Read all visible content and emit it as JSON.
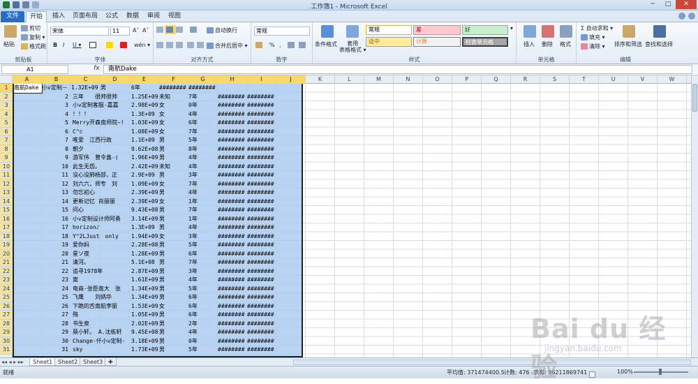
{
  "window": {
    "title": "工作簿1 - Microsoft Excel"
  },
  "tabs": [
    "文件",
    "开始",
    "插入",
    "页面布局",
    "公式",
    "数据",
    "审阅",
    "视图"
  ],
  "ribbon": {
    "clipboard": {
      "paste": "粘贴",
      "cut": "剪切",
      "copy": "复制 ▾",
      "format_painter": "格式刷",
      "label": "剪贴板"
    },
    "font": {
      "name": "宋体",
      "size": "11",
      "grow": "A˄",
      "shrink": "A˅",
      "bold": "B",
      "italic": "I",
      "underline": "U ▾",
      "label": "字体",
      "phonetic": "wén ▾"
    },
    "alignment": {
      "wrap": "自动换行",
      "merge": "合并后居中 ▾",
      "label": "对齐方式"
    },
    "number": {
      "format": "常规",
      "percent": "%",
      "comma": ",",
      "label": "数字"
    },
    "styles": {
      "conditional": "条件格式",
      "table_format": "套用\n表格格式 ▾",
      "normal": "常规",
      "bad": "差",
      "good": "好",
      "neutral": "适中",
      "calc": "计算",
      "check": "检查单元格",
      "label": "样式"
    },
    "cells": {
      "insert": "插入",
      "delete": "删除",
      "format": "格式",
      "label": "单元格"
    },
    "editing": {
      "autosum": "Σ 自动求和 ▾",
      "fill": "填充 ▾",
      "clear": "清除 ▾",
      "sort": "排序和筛选",
      "find": "查找和选择",
      "label": "编辑"
    },
    "colors": {
      "file_tab": "#2a6cc0",
      "bad_bg": "#ffc7ce",
      "good_bg": "#c6efce",
      "neutral_bg": "#ffeb9c",
      "calc_bg": "#f2f2f2",
      "check_bg": "#a5a5a5"
    }
  },
  "formula_bar": {
    "name_box": "A1",
    "fx": "fx",
    "value": "南航Dake"
  },
  "columns": [
    "A",
    "B",
    "C",
    "D",
    "E",
    "F",
    "G",
    "H",
    "I",
    "J",
    "K",
    "L",
    "M",
    "N",
    "O",
    "P",
    "Q",
    "R",
    "S",
    "T",
    "U",
    "V",
    "W"
  ],
  "rows": [
    [
      "南航Dake",
      "小v定制－",
      "1.32E+09",
      "男",
      "",
      "6年",
      "########",
      "########"
    ],
    [
      "",
      "2",
      "三年　　很帅很帅",
      "1.25E+09",
      "未知",
      "7年",
      "########",
      "########"
    ],
    [
      "",
      "3",
      "小v定制客服-嘉嘉",
      "2.98E+09",
      "女",
      "0年",
      "########",
      "########"
    ],
    [
      "",
      "4",
      "！！！",
      "1.3E+09",
      "女",
      "4年",
      "########",
      "########"
    ],
    [
      "",
      "5",
      "Merry开森南师院~!",
      "1.03E+09",
      "女",
      "6年",
      "########",
      "########"
    ],
    [
      "",
      "6",
      "C^c",
      "1.08E+09",
      "女",
      "7年",
      "########",
      "########"
    ],
    [
      "",
      "7",
      "唯爱　江西行政",
      "1.1E+09",
      "男",
      "5年",
      "########",
      "########"
    ],
    [
      "",
      "8",
      "朝夕",
      "9.62E+08",
      "男",
      "8年",
      "########",
      "########"
    ],
    [
      "",
      "9",
      "游军伟　曾令鑫-(",
      "1.96E+09",
      "男",
      "4年",
      "########",
      "########"
    ],
    [
      "",
      "10",
      "此生无怨。",
      "2.42E+09",
      "未知",
      "4年",
      "########",
      "########"
    ],
    [
      "",
      "11",
      "没心没肺杨部，正",
      "2.9E+09",
      "男",
      "3年",
      "########",
      "########"
    ],
    [
      "",
      "12",
      "刘六六，师专　刘",
      "1.09E+09",
      "女",
      "7年",
      "########",
      "########"
    ],
    [
      "",
      "13",
      "勿忘初心",
      "2.39E+09",
      "男",
      "4年",
      "########",
      "########"
    ],
    [
      "",
      "14",
      "更新记忆 肖丽丽",
      "2.39E+09",
      "女",
      "1年",
      "########",
      "########"
    ],
    [
      "",
      "15",
      "问心",
      "9.43E+08",
      "男",
      "7年",
      "########",
      "########"
    ],
    [
      "",
      "16",
      "小v定制设计师阿勇",
      "3.14E+09",
      "男",
      "1年",
      "########",
      "########"
    ],
    [
      "",
      "17",
      "horizon♪",
      "1.3E+09",
      "男",
      "4年",
      "########",
      "########"
    ],
    [
      "",
      "18",
      "Y^2LJust　only",
      "1.94E+09",
      "女",
      "3年",
      "########",
      "########"
    ],
    [
      "",
      "19",
      "爱你妈",
      "2.28E+08",
      "男",
      "5年",
      "########",
      "########"
    ],
    [
      "",
      "20",
      "星ソ夜",
      "1.28E+09",
      "男",
      "6年",
      "########",
      "########"
    ],
    [
      "",
      "21",
      "清河。",
      "5.1E+08",
      "男",
      "7年",
      "########",
      "########"
    ],
    [
      "",
      "22",
      "追寻1978年",
      "2.87E+09",
      "男",
      "3年",
      "########",
      "########"
    ],
    [
      "",
      "23",
      "寞",
      "1.61E+09",
      "男",
      "4年",
      "########",
      "########"
    ],
    [
      "",
      "24",
      "电商-张臣南大　张",
      "1.34E+09",
      "男",
      "5年",
      "########",
      "########"
    ],
    [
      "",
      "25",
      "飞鹰　　刘炳华",
      "1.34E+09",
      "男",
      "6年",
      "########",
      "########"
    ],
    [
      "",
      "26",
      "下跪的舌南航李丽",
      "1.53E+09",
      "女",
      "6年",
      "########",
      "########"
    ],
    [
      "",
      "27",
      "殇",
      "1.05E+09",
      "男",
      "6年",
      "########",
      "########"
    ],
    [
      "",
      "28",
      "书生泉",
      "2.02E+09",
      "男",
      "2年",
      "########",
      "########"
    ],
    [
      "",
      "29",
      "莫小轩。 A.沈栋轩",
      "9.45E+08",
      "男",
      "4年",
      "########",
      "########"
    ],
    [
      "",
      "30",
      "Change-仟小v定制-",
      "3.18E+09",
      "男",
      "0年",
      "########",
      "########"
    ],
    [
      "",
      "31",
      "sky",
      "1.73E+09",
      "男",
      "5年",
      "########",
      "########"
    ]
  ],
  "row_numbers": [
    "1",
    "2",
    "3",
    "4",
    "5",
    "6",
    "7",
    "8",
    "9",
    "10",
    "11",
    "12",
    "13",
    "14",
    "15",
    "16",
    "17",
    "18",
    "19",
    "20",
    "21",
    "22",
    "23",
    "24",
    "25",
    "26",
    "27",
    "28",
    "29",
    "30",
    "31"
  ],
  "sheets": [
    "Sheet1",
    "Sheet2",
    "Sheet3"
  ],
  "status": {
    "ready": "就绪",
    "average": "平均值: 371474400.5",
    "count": "计数: 476",
    "sum": "求和: 96211869741",
    "zoom": "100%"
  },
  "watermark": {
    "brand": "Bai du 经验",
    "url": "jingyan.baidu.com"
  }
}
